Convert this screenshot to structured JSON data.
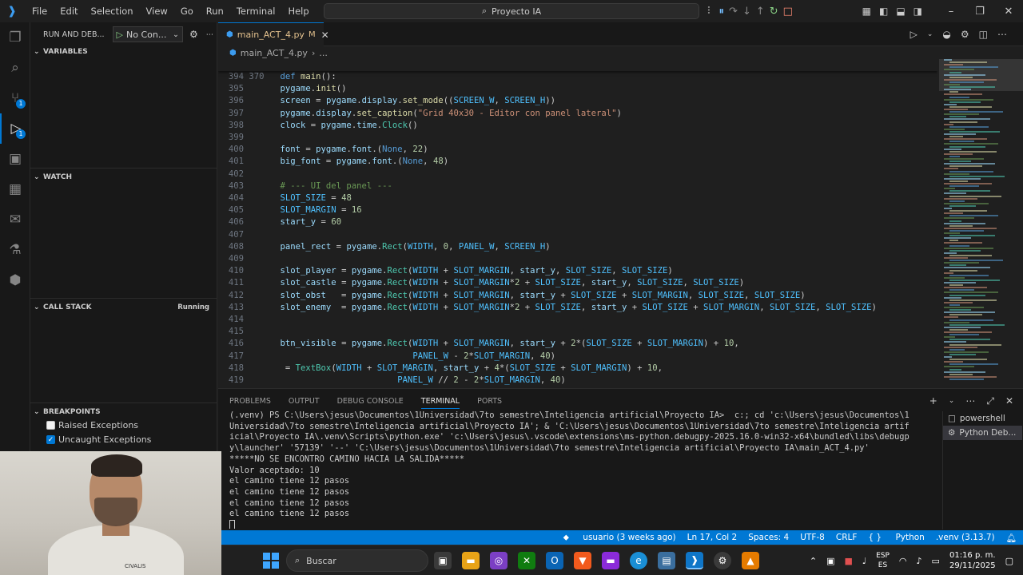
{
  "menu": [
    "File",
    "Edit",
    "Selection",
    "View",
    "Go",
    "Run",
    "Terminal",
    "Help"
  ],
  "search_title": "Proyecto IA",
  "sidebar": {
    "title": "RUN AND DEB...",
    "config": "No Con...",
    "sections": {
      "variables": "VARIABLES",
      "watch": "WATCH",
      "call_stack": "CALL STACK",
      "call_stack_status": "Running",
      "breakpoints": "BREAKPOINTS"
    },
    "breakpoints": [
      {
        "label": "Raised Exceptions",
        "checked": false
      },
      {
        "label": "Uncaught Exceptions",
        "checked": true
      }
    ]
  },
  "badges": {
    "scm": "1",
    "debug": "1"
  },
  "tab": {
    "name": "main_ACT_4.py",
    "modified": "M"
  },
  "breadcrumb": {
    "file": "main_ACT_4.py",
    "rest": "..."
  },
  "sticky_line": {
    "num": "370",
    "text": "def main():"
  },
  "code_lines": [
    {
      "num": "394",
      "text": ""
    },
    {
      "num": "395",
      "text": "    pygame.init()"
    },
    {
      "num": "396",
      "text": "    screen = pygame.display.set_mode((SCREEN_W, SCREEN_H))"
    },
    {
      "num": "397",
      "text": "    pygame.display.set_caption(\"Grid 40x30 - Editor con panel lateral\")"
    },
    {
      "num": "398",
      "text": "    clock = pygame.time.Clock()"
    },
    {
      "num": "399",
      "text": ""
    },
    {
      "num": "400",
      "text": "    font = pygame.font.SysFont(None, 22)"
    },
    {
      "num": "401",
      "text": "    big_font = pygame.font.SysFont(None, 48)"
    },
    {
      "num": "402",
      "text": ""
    },
    {
      "num": "403",
      "text": "    # --- UI del panel ---"
    },
    {
      "num": "404",
      "text": "    SLOT_SIZE = 48"
    },
    {
      "num": "405",
      "text": "    SLOT_MARGIN = 16"
    },
    {
      "num": "406",
      "text": "    start_y = 60"
    },
    {
      "num": "407",
      "text": ""
    },
    {
      "num": "408",
      "text": "    panel_rect = pygame.Rect(WIDTH, 0, PANEL_W, SCREEN_H)"
    },
    {
      "num": "409",
      "text": ""
    },
    {
      "num": "410",
      "text": "    slot_player = pygame.Rect(WIDTH + SLOT_MARGIN, start_y, SLOT_SIZE, SLOT_SIZE)"
    },
    {
      "num": "411",
      "text": "    slot_castle = pygame.Rect(WIDTH + SLOT_MARGIN*2 + SLOT_SIZE, start_y, SLOT_SIZE, SLOT_SIZE)"
    },
    {
      "num": "412",
      "text": "    slot_obst   = pygame.Rect(WIDTH + SLOT_MARGIN, start_y + SLOT_SIZE + SLOT_MARGIN, SLOT_SIZE, SLOT_SIZE)"
    },
    {
      "num": "413",
      "text": "    slot_enemy  = pygame.Rect(WIDTH + SLOT_MARGIN*2 + SLOT_SIZE, start_y + SLOT_SIZE + SLOT_MARGIN, SLOT_SIZE, SLOT_SIZE)"
    },
    {
      "num": "414",
      "text": ""
    },
    {
      "num": "415",
      "text": ""
    },
    {
      "num": "416",
      "text": "    btn_visible = pygame.Rect(WIDTH + SLOT_MARGIN, start_y + 2*(SLOT_SIZE + SLOT_MARGIN) + 10,"
    },
    {
      "num": "417",
      "text": "                              PANEL_W - 2*SLOT_MARGIN, 40)"
    },
    {
      "num": "418",
      "text": "    text_box1 = TextBox(WIDTH + SLOT_MARGIN, start_y + 4*(SLOT_SIZE + SLOT_MARGIN) + 10,"
    },
    {
      "num": "419",
      "text": "                           PANEL_W // 2 - 2*SLOT_MARGIN, 40)"
    }
  ],
  "panel": {
    "tabs": [
      "PROBLEMS",
      "OUTPUT",
      "DEBUG CONSOLE",
      "TERMINAL",
      "PORTS"
    ],
    "active_tab": "TERMINAL",
    "terminal_lines": [
      "(.venv) PS C:\\Users\\jesus\\Documentos\\1Universidad\\7to semestre\\Inteligencia artificial\\Proyecto IA>  c:; cd 'c:\\Users\\jesus\\Documentos\\1",
      "Universidad\\7to semestre\\Inteligencia artificial\\Proyecto IA'; & 'C:\\Users\\jesus\\Documentos\\1Universidad\\7to semestre\\Inteligencia artif",
      "icial\\Proyecto IA\\.venv\\Scripts\\python.exe' 'c:\\Users\\jesus\\.vscode\\extensions\\ms-python.debugpy-2025.16.0-win32-x64\\bundled\\libs\\debugp",
      "y\\launcher' '57139' '--' 'C:\\Users\\jesus\\Documentos\\1Universidad\\7to semestre\\Inteligencia artificial\\Proyecto IA\\main_ACT_4.py'",
      "*****NO SE ENCONTRO CAMINO HACIA LA SALIDA*****",
      "Valor aceptado: 10",
      "el camino tiene 12 pasos",
      "el camino tiene 12 pasos",
      "el camino tiene 12 pasos",
      "el camino tiene 12 pasos"
    ],
    "terminals": [
      "powershell",
      "Python Deb..."
    ]
  },
  "statusbar": {
    "blame": "usuario (3 weeks ago)",
    "position": "Ln 17, Col 2",
    "spaces": "Spaces: 4",
    "encoding": "UTF-8",
    "eol": "CRLF",
    "language": "Python",
    "interpreter": ".venv (3.13.7)"
  },
  "taskbar": {
    "search": "Buscar",
    "lang_top": "ESP",
    "lang_bottom": "ES",
    "time": "01:16 p. m.",
    "date": "29/11/2025"
  },
  "webcam": {
    "shirt_text": "CIVALIS"
  }
}
